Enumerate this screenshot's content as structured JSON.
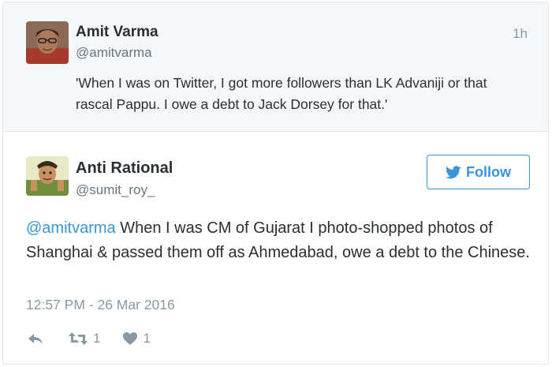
{
  "parent_tweet": {
    "name": "Amit Varma",
    "handle": "@amitvarma",
    "time": "1h",
    "text": "'When I was on Twitter, I got more followers than LK Advaniji or that rascal Pappu. I owe a debt to Jack Dorsey for that.'"
  },
  "tweet": {
    "name": "Anti Rational",
    "handle": "@sumit_roy_",
    "follow_label": "Follow",
    "mention": "@amitvarma",
    "text": " When I was CM of Gujarat I photo-shopped photos of Shanghai & passed them off as Ahmedabad, owe a debt to the Chinese.",
    "timestamp": "12:57 PM - 26 Mar 2016",
    "retweet_count": "1",
    "like_count": "1"
  },
  "icons": {
    "follow": "bird-icon",
    "reply": "reply-icon",
    "retweet": "retweet-icon",
    "like": "heart-icon"
  },
  "colors": {
    "link": "#3b94d9",
    "muted": "#8899a6",
    "parent_bg": "#f5f8fa"
  }
}
